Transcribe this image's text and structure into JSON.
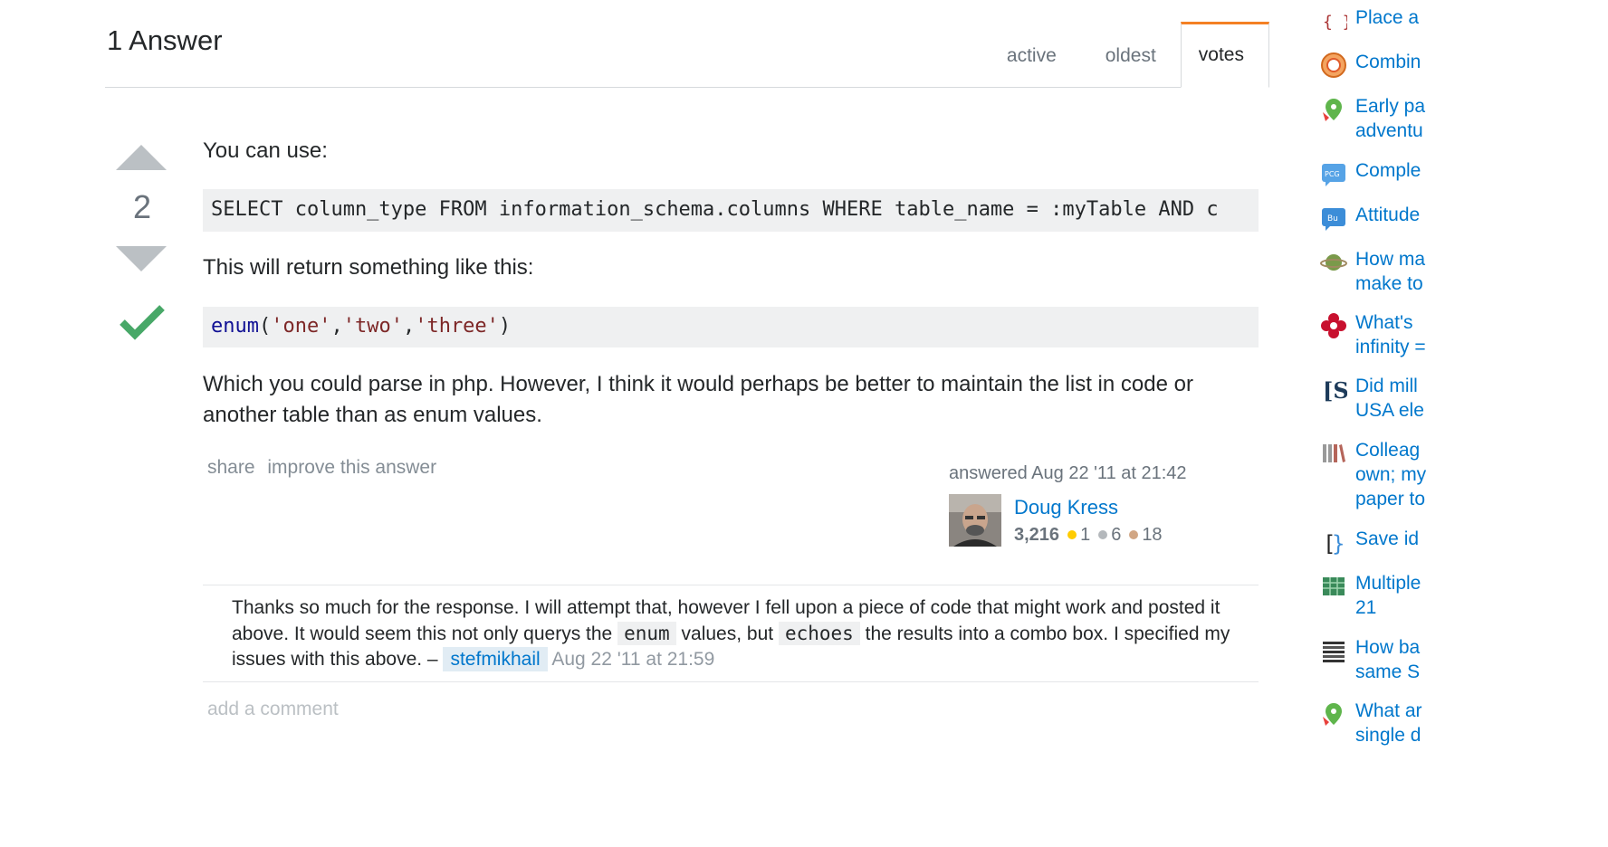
{
  "answers": {
    "count_label": "1 Answer",
    "tabs": [
      "active",
      "oldest",
      "votes"
    ]
  },
  "answer": {
    "votes": "2",
    "intro": "You can use:",
    "code1": "SELECT column_type FROM information_schema.columns WHERE table_name = :myTable AND c",
    "middle": "This will return something like this:",
    "code2_tokens": [
      "enum",
      "(",
      "'one'",
      ",",
      "'two'",
      ",",
      "'three'",
      ")"
    ],
    "conclusion": "Which you could parse in php. However, I think it would perhaps be better to maintain the list in code or another table than as enum values.",
    "menu": [
      "share",
      "improve this answer"
    ],
    "action_time": "answered Aug 22 '11 at 21:42",
    "user": {
      "name": "Doug Kress",
      "reputation": "3,216",
      "gold": "1",
      "silver": "6",
      "bronze": "18"
    }
  },
  "comment": {
    "text_a": "Thanks so much for the response. I will attempt that, however I fell upon a piece of code that might work and posted it above. It would seem this not only querys the",
    "code_a": "enum",
    "text_b": "values, but",
    "code_b": "echoes",
    "text_c": "the results into a combo box. I specified my issues with this above. –",
    "user": "stefmikhail",
    "date": "Aug 22 '11 at 21:59"
  },
  "add_comment": "add a comment",
  "hot_questions": [
    {
      "icon": "curly-braces-icon",
      "line1": "Place a",
      "line2": ""
    },
    {
      "icon": "mandala-icon",
      "line1": "Combin",
      "line2": ""
    },
    {
      "icon": "pin-balloon-icon",
      "line1": "Early pa",
      "line2": "adventu"
    },
    {
      "icon": "pcg-bubble-icon",
      "line1": "Comple",
      "line2": ""
    },
    {
      "icon": "bu-bubble-icon",
      "line1": "Attitude",
      "line2": ""
    },
    {
      "icon": "planet-icon",
      "line1": "How ma",
      "line2": "make to"
    },
    {
      "icon": "red-flower-icon",
      "line1": "What's",
      "line2": "infinity ="
    },
    {
      "icon": "skeptics-s-icon",
      "line1": "Did mill",
      "line2": "USA ele"
    },
    {
      "icon": "books-icon",
      "line1": "Colleag",
      "line2": "own; my",
      "line3": "paper to"
    },
    {
      "icon": "bracket-brain-icon",
      "line1": "Save id",
      "line2": ""
    },
    {
      "icon": "grid-cube-icon",
      "line1": "Multiple",
      "line2": "21"
    },
    {
      "icon": "bars-grid-icon",
      "line1": "How ba",
      "line2": "same S"
    },
    {
      "icon": "pin-balloon-icon",
      "line1": "What ar",
      "line2": "single d"
    }
  ],
  "colors": {
    "link": "#0077cc",
    "accent_tab": "#f48024",
    "accepted": "#48a868",
    "code_bg": "#eff0f1"
  }
}
